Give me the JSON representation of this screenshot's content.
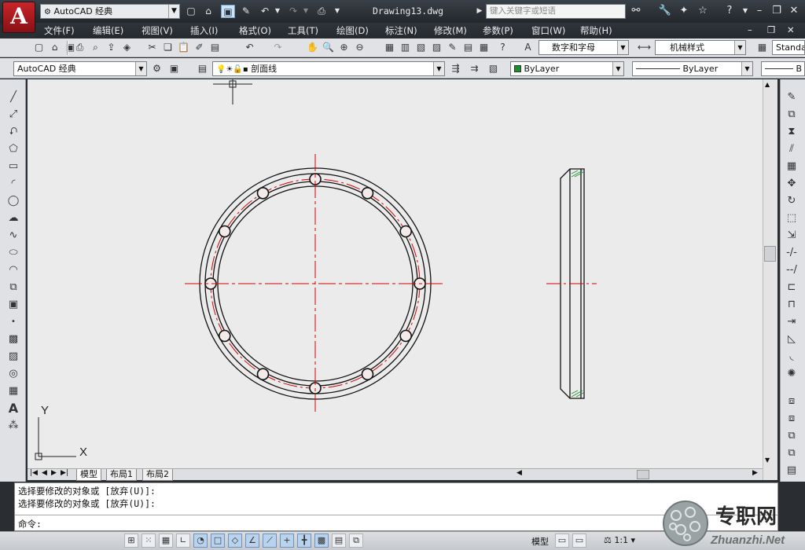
{
  "title_bar": {
    "workspace": "AutoCAD 经典",
    "document_title": "Drawing13.dwg",
    "search_placeholder": "键入关键字或短语"
  },
  "menu": [
    "文件(F)",
    "编辑(E)",
    "视图(V)",
    "插入(I)",
    "格式(O)",
    "工具(T)",
    "绘图(D)",
    "标注(N)",
    "修改(M)",
    "参数(P)",
    "窗口(W)",
    "帮助(H)"
  ],
  "styles": {
    "text_style": "数字和字母",
    "dim_style": "机械样式",
    "table_style": "Standa"
  },
  "layers": {
    "workspace": "AutoCAD 经典",
    "current_layer": "剖面线",
    "color": "ByLayer",
    "linetype": "ByLayer",
    "lineweight": "B"
  },
  "ucs": {
    "x_label": "X",
    "y_label": "Y"
  },
  "layout_tabs": [
    "模型",
    "布局1",
    "布局2"
  ],
  "command": {
    "history": [
      "选择要修改的对象或 [放弃(U)]:",
      "选择要修改的对象或 [放弃(U)]:"
    ],
    "prompt": "命令:"
  },
  "status": {
    "model_label": "模型",
    "scale": "1:1"
  },
  "watermark": {
    "brand": "专职网",
    "url": "Zhuanzhi.Net"
  },
  "colors": {
    "centerline": "#d40000",
    "geometry": "#111111",
    "canvas": "#ebebeb"
  }
}
